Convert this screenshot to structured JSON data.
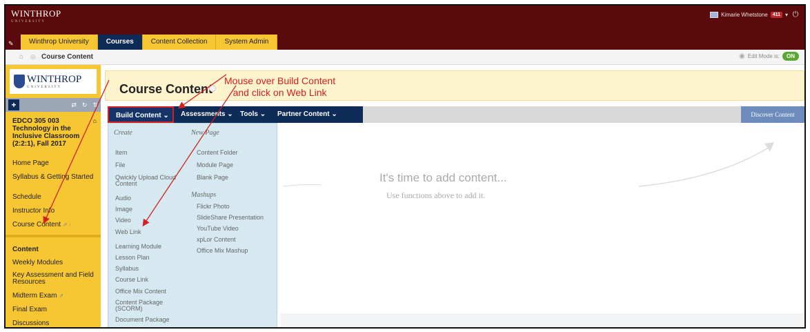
{
  "topbar": {
    "logo": "WINTHROP",
    "logo_sub": "UNIVERSITY",
    "user_name": "Kimarie Whetstone",
    "notification_count": "411"
  },
  "tabs": [
    {
      "label": "Winthrop University",
      "active": false
    },
    {
      "label": "Courses",
      "active": true
    },
    {
      "label": "Content Collection",
      "active": false
    },
    {
      "label": "System Admin",
      "active": false
    }
  ],
  "breadcrumb": {
    "current": "Course Content"
  },
  "edit_mode": {
    "label": "Edit Mode is:",
    "state": "ON"
  },
  "sidebar": {
    "logo": "WINTHROP",
    "logo_sub": "UNIVERSITY",
    "course_title": "EDCO 305 003 Technology in the Inclusive Classroom (2:2:1), Fall 2017",
    "links": [
      "Home Page",
      "Syllabus & Getting Started",
      "Schedule",
      "Instructor Info",
      "Course Content"
    ],
    "section_heading": "Content",
    "section_links": [
      "Weekly Modules",
      "Key Assessment and Field Resources",
      "Midterm Exam",
      "Final Exam",
      "Discussions"
    ]
  },
  "main": {
    "title": "Course Content",
    "annotation": "Mouse over Build Content\nand click on Web Link",
    "actions": [
      "Build Content",
      "Assessments",
      "Tools",
      "Partner Content"
    ],
    "discover": "Discover Content",
    "empty_title": "It's time to add content...",
    "empty_sub": "Use functions above to add it."
  },
  "dropdown": {
    "create_head": "Create",
    "create_items": [
      "Item",
      "File",
      "Qwickly Upload Cloud Content",
      "Audio",
      "Image",
      "Video",
      "Web Link",
      "Learning Module",
      "Lesson Plan",
      "Syllabus",
      "Course Link",
      "Office Mix Content",
      "Content Package (SCORM)",
      "Document Package"
    ],
    "newpage_head": "New Page",
    "newpage_items": [
      "Content Folder",
      "Module Page",
      "Blank Page"
    ],
    "mashups_head": "Mashups",
    "mashups_items": [
      "Flickr Photo",
      "SlideShare Presentation",
      "YouTube Video",
      "xpLor Content",
      "Office Mix Mashup"
    ]
  },
  "colors": {
    "maroon": "#5a0a0a",
    "gold": "#f7c633",
    "navy": "#0e2a56",
    "annotation_red": "#d32020"
  }
}
